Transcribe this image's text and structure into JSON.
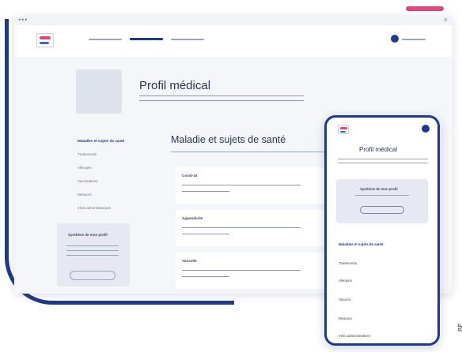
{
  "window": {
    "dots": "•••",
    "close": "×"
  },
  "profile": {
    "title": "Profil médical"
  },
  "sidebar": {
    "items": [
      {
        "label": "Maladies et sujets de santé",
        "active": true
      },
      {
        "label": "Traitements",
        "active": false
      },
      {
        "label": "Allergies",
        "active": false
      },
      {
        "label": "Vaccinations",
        "active": false
      },
      {
        "label": "Mesures",
        "active": false
      },
      {
        "label": "Infos administratives",
        "active": false
      }
    ],
    "summary_card_title": "Synthèse de mon profil"
  },
  "section": {
    "title": "Maladie et sujets de santé",
    "cards": [
      {
        "label": "Covid-19"
      },
      {
        "label": "Appendicite"
      },
      {
        "label": "Varicelle"
      }
    ]
  },
  "phone": {
    "title": "Profil médical",
    "summary_card_title": "Synthèse de mon profil",
    "items": [
      {
        "label": "Maladies et sujets de santé",
        "active": true
      },
      {
        "label": "Traitements",
        "active": false
      },
      {
        "label": "Allergies",
        "active": false
      },
      {
        "label": "Vaccins",
        "active": false
      },
      {
        "label": "Mesures",
        "active": false
      },
      {
        "label": "Infos administratives",
        "active": false
      }
    ]
  },
  "edge_text": "BE",
  "colors": {
    "accent_navy": "#1f3a8a",
    "accent_pink": "#e0457b",
    "background_panel": "#f4f6fa"
  }
}
